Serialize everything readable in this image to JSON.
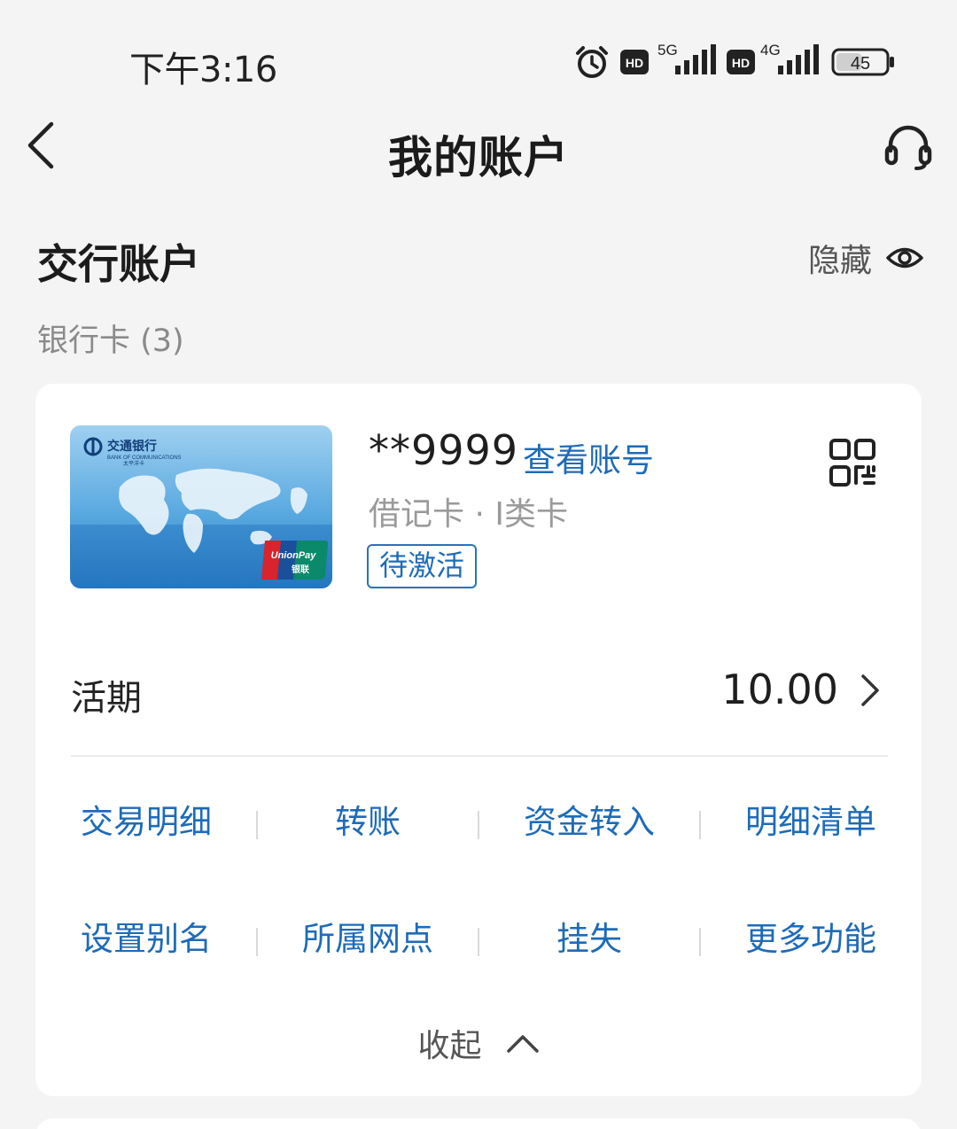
{
  "status_bar": {
    "time": "下午3:16",
    "network_1": "5G",
    "network_2": "4G",
    "hd_label": "HD",
    "battery": "45"
  },
  "nav": {
    "title": "我的账户",
    "back_icon": "chevron-left-icon",
    "service_icon": "headset-icon"
  },
  "section": {
    "title": "交行账户",
    "hide_label": "隐藏",
    "card_count": "银行卡 (3)"
  },
  "card": {
    "number": "**9999",
    "view_account": "查看账号",
    "type": "借记卡 · I类卡",
    "status": "待激活",
    "image_bank_name": "交通银行",
    "image_bank_name_en": "BANK OF COMMUNICATIONS",
    "image_card_name": "太平洋卡",
    "image_network": "UnionPay",
    "image_network_cn": "银联"
  },
  "balance": {
    "label": "活期",
    "value": "10.00"
  },
  "actions": [
    [
      "交易明细",
      "转账",
      "资金转入",
      "明细清单"
    ],
    [
      "设置别名",
      "所属网点",
      "挂失",
      "更多功能"
    ]
  ],
  "collapse_label": "收起",
  "colors": {
    "accent": "#1d6bb8",
    "background": "#f4f4f4",
    "card": "#ffffff"
  }
}
